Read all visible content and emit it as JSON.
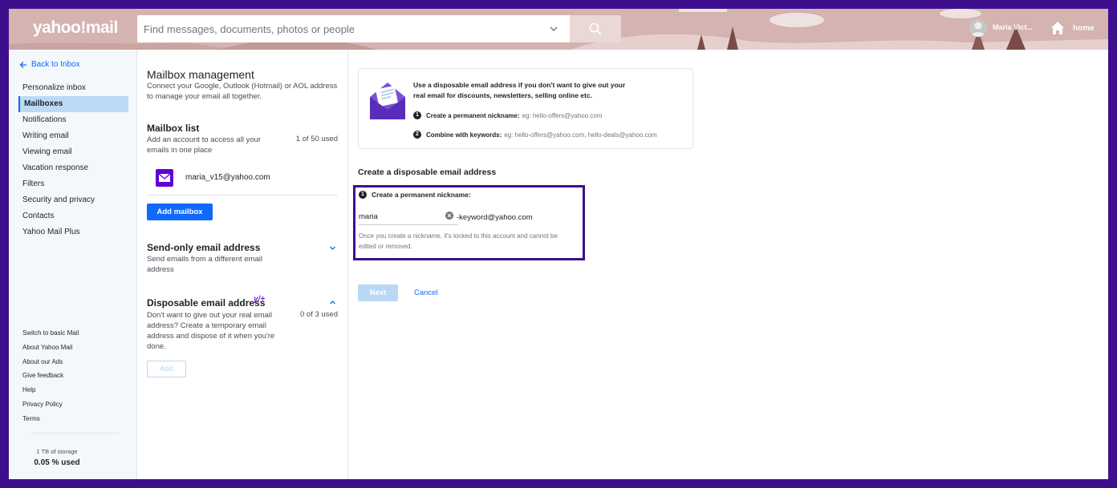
{
  "app": {
    "logo": "yahoo!mail"
  },
  "search": {
    "placeholder": "Find messages, documents, photos or people"
  },
  "user": {
    "name": "Maria Vict..."
  },
  "home": {
    "label": "home"
  },
  "sidebar": {
    "back_label": "Back to Inbox",
    "items": [
      {
        "label": "Personalize inbox"
      },
      {
        "label": "Mailboxes"
      },
      {
        "label": "Notifications"
      },
      {
        "label": "Writing email"
      },
      {
        "label": "Viewing email"
      },
      {
        "label": "Vacation response"
      },
      {
        "label": "Filters"
      },
      {
        "label": "Security and privacy"
      },
      {
        "label": "Contacts"
      },
      {
        "label": "Yahoo Mail Plus"
      }
    ],
    "footer_links": [
      "Switch to basic Mail",
      "About Yahoo Mail",
      "About our Ads",
      "Give feedback",
      "Help",
      "Privacy Policy",
      "Terms"
    ],
    "storage_total": "1 TB of storage",
    "storage_used": "0.05 % used"
  },
  "mailbox_management": {
    "title": "Mailbox management",
    "description": "Connect your Google, Outlook (Hotmail) or AOL address to manage your email all together.",
    "mailbox_list": {
      "heading": "Mailbox list",
      "description": "Add an account to access all your emails in one place",
      "used": "1 of 50 used",
      "address": "maria_v15@yahoo.com",
      "add_button": "Add mailbox"
    },
    "send_only": {
      "heading": "Send-only email address",
      "description": "Send emails from a different email address"
    },
    "disposable": {
      "heading": "Disposable email address",
      "badge": "y/+",
      "description": "Don't want to give out your real email address? Create a temporary email address and dispose of it when you're done.",
      "used": "0 of 3 used",
      "add_button": "Add"
    }
  },
  "info": {
    "text": "Use a disposable email address if you don't want to give out your real email for discounts, newsletters, selling online etc.",
    "step1_num": "1",
    "step1_label": "Create a permanent nickname:",
    "step1_example": "eg: hello-offers@yahoo.com",
    "step2_num": "2",
    "step2_label": "Combine with keywords:",
    "step2_example": "eg: hello-offers@yahoo.com, hello-deals@yahoo.com"
  },
  "create": {
    "title": "Create a disposable email address",
    "step_num": "1",
    "step_label": "Create a permanent nickname:",
    "nickname_value": "maria",
    "suffix": "-keyword@yahoo.com",
    "hint": "Once you create a nickname, it's locked to this account and cannot be edited or removed.",
    "next_button": "Next",
    "cancel_button": "Cancel"
  }
}
